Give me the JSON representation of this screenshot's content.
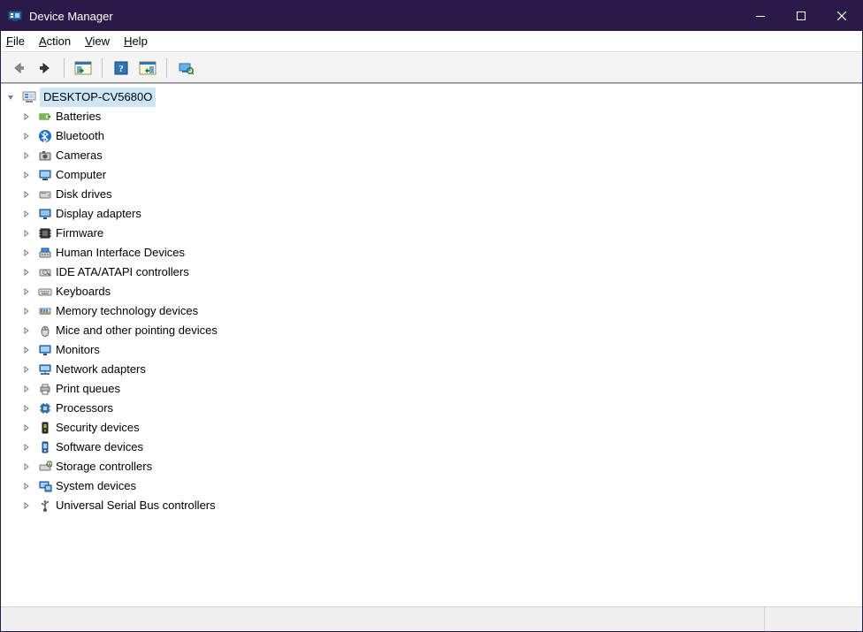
{
  "window": {
    "title": "Device Manager"
  },
  "menus": {
    "file": "File",
    "action": "Action",
    "view": "View",
    "help": "Help"
  },
  "toolbar": {
    "back": "back-icon",
    "forward": "forward-icon",
    "show_hide_tree": "show-hide-console-tree-icon",
    "help2": "help-icon",
    "action_window": "show-action-window-icon",
    "scan": "scan-hardware-icon"
  },
  "tree": {
    "root": {
      "label": "DESKTOP-CV5680O",
      "expanded": true,
      "icon": "computer-root-icon"
    },
    "children": [
      {
        "label": "Batteries",
        "icon": "battery-icon"
      },
      {
        "label": "Bluetooth",
        "icon": "bluetooth-icon"
      },
      {
        "label": "Cameras",
        "icon": "camera-icon"
      },
      {
        "label": "Computer",
        "icon": "computer-icon"
      },
      {
        "label": "Disk drives",
        "icon": "disk-icon"
      },
      {
        "label": "Display adapters",
        "icon": "display-adapter-icon"
      },
      {
        "label": "Firmware",
        "icon": "firmware-icon"
      },
      {
        "label": "Human Interface Devices",
        "icon": "hid-icon"
      },
      {
        "label": "IDE ATA/ATAPI controllers",
        "icon": "ide-icon"
      },
      {
        "label": "Keyboards",
        "icon": "keyboard-icon"
      },
      {
        "label": "Memory technology devices",
        "icon": "memory-icon"
      },
      {
        "label": "Mice and other pointing devices",
        "icon": "mouse-icon"
      },
      {
        "label": "Monitors",
        "icon": "monitor-icon"
      },
      {
        "label": "Network adapters",
        "icon": "network-icon"
      },
      {
        "label": "Print queues",
        "icon": "printer-icon"
      },
      {
        "label": "Processors",
        "icon": "cpu-icon"
      },
      {
        "label": "Security devices",
        "icon": "security-icon"
      },
      {
        "label": "Software devices",
        "icon": "software-icon"
      },
      {
        "label": "Storage controllers",
        "icon": "storage-icon"
      },
      {
        "label": "System devices",
        "icon": "system-icon"
      },
      {
        "label": "Universal Serial Bus controllers",
        "icon": "usb-icon"
      }
    ]
  }
}
